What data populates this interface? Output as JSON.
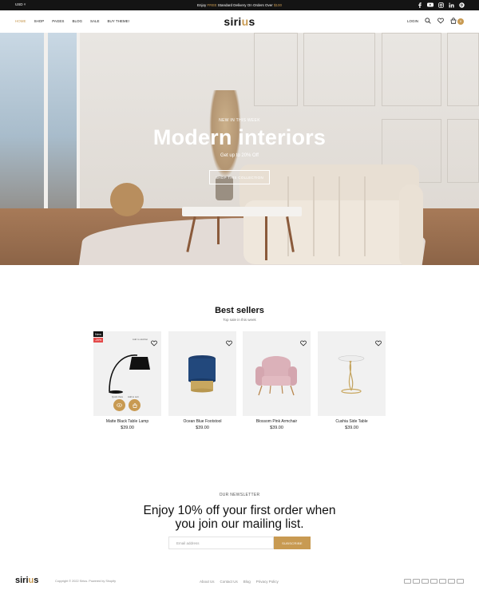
{
  "topbar": {
    "currency": "USD",
    "promo_prefix": "Enjoy ",
    "promo_highlight": "FREE",
    "promo_middle": " Standard Delivery On Orders Over ",
    "promo_amount": "$100",
    "socials": [
      "facebook-icon",
      "youtube-icon",
      "instagram-icon",
      "linkedin-icon",
      "pinterest-icon"
    ]
  },
  "header": {
    "nav": [
      "HOME",
      "SHOP",
      "PAGES",
      "BLOG",
      "SALE",
      "BUY THEME!"
    ],
    "logo_start": "siri",
    "logo_accent": "u",
    "logo_end": "s",
    "login": "LOGIN",
    "cart_count": "0"
  },
  "hero": {
    "kicker": "NEW IN THIS WEEK",
    "title": "Modern interiors",
    "subtitle": "Get up to 20% Off",
    "button": "SHOP THIS COLLECTION"
  },
  "bestsellers": {
    "title": "Best sellers",
    "subtitle": "Top sale in this week",
    "products": [
      {
        "name": "Matte Black Table Lamp",
        "price": "$39.00"
      },
      {
        "name": "Ocean Blue Footstool",
        "price": "$39.00"
      },
      {
        "name": "Blossom Pink Armchair",
        "price": "$39.00"
      },
      {
        "name": "Cushia Side Table",
        "price": "$39.00"
      }
    ],
    "badge_new": "New",
    "badge_sale": "-20%",
    "add_to_wishlist": "Add to wishlist",
    "quick_view": "Quick View",
    "add_to_cart": "Add to cart"
  },
  "newsletter": {
    "kicker": "OUR NEWSLETTER",
    "title_line1": "Enjoy 10% off your first order when",
    "title_line2": "you join our mailing list.",
    "placeholder": "Email address",
    "button": "SUBSCRIBE"
  },
  "footer": {
    "logo_start": "siri",
    "logo_accent": "u",
    "logo_end": "s",
    "copyright": "Copyright © 2022 Sirius. Powered by Shopify",
    "links": [
      "About Us",
      "Contact Us",
      "Blog",
      "Privacy Policy"
    ],
    "payments": [
      "visa",
      "mastercard",
      "amex",
      "diners",
      "discover",
      "jcb",
      "paypal"
    ]
  },
  "colors": {
    "accent": "#c89a52",
    "dark": "#141414",
    "sale": "#e44a4a"
  }
}
